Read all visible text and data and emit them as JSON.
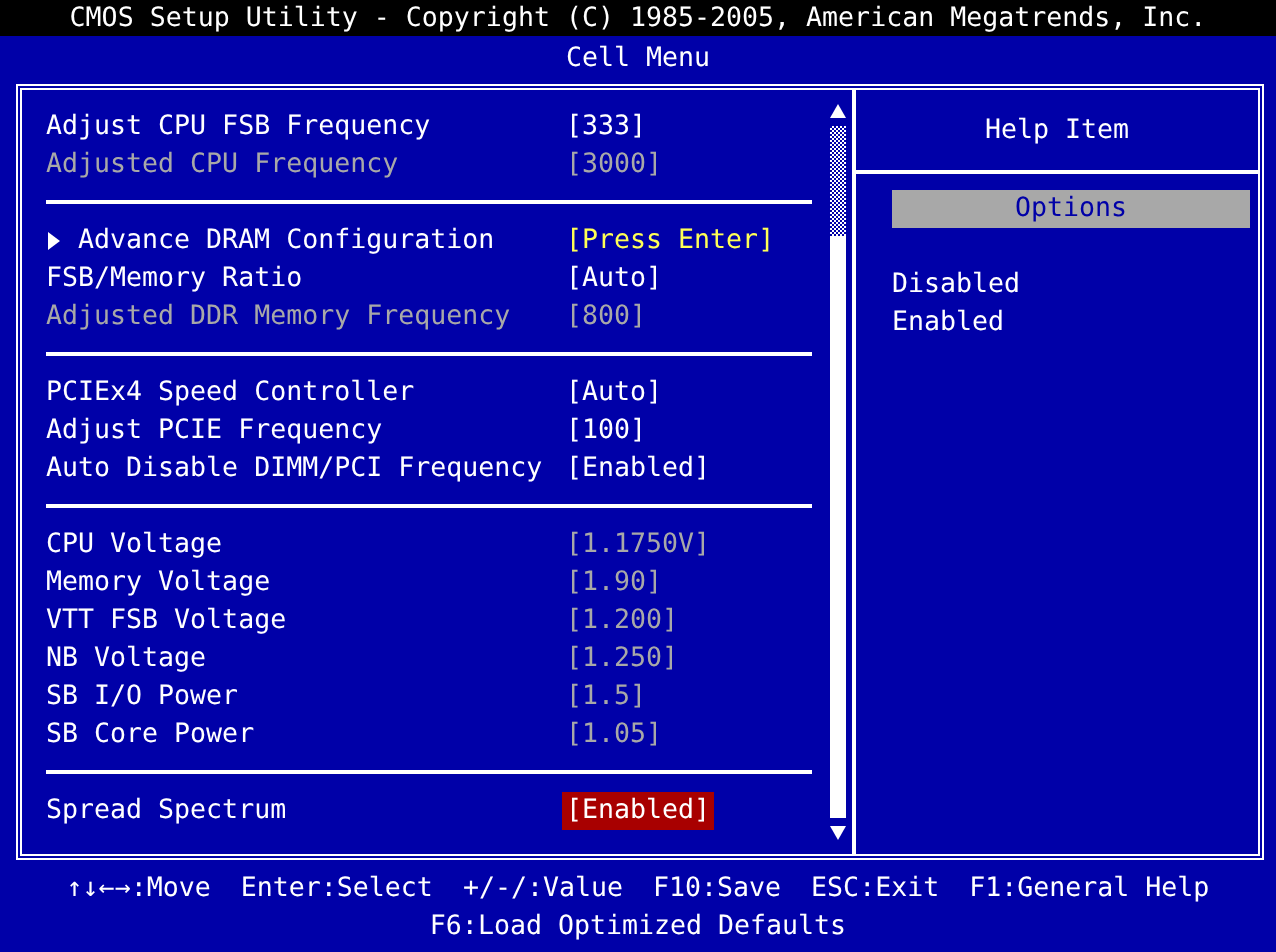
{
  "title_bar": {
    "title": "CMOS Setup Utility - Copyright (C) 1985-2005, American Megatrends, Inc."
  },
  "menu_title": "Cell Menu",
  "settings": {
    "groups": [
      {
        "items": [
          {
            "kind": "setting",
            "label": "Adjust CPU FSB Frequency",
            "value": "[333]",
            "disabled": false,
            "value_disabled": false,
            "selected": false
          },
          {
            "kind": "setting",
            "label": "Adjusted CPU Frequency",
            "value": "[3000]",
            "disabled": true,
            "value_disabled": true,
            "selected": false
          }
        ]
      },
      {
        "items": [
          {
            "kind": "submenu",
            "label": "Advance DRAM Configuration",
            "value": "[Press Enter]",
            "disabled": false,
            "value_disabled": false,
            "selected": false
          },
          {
            "kind": "setting",
            "label": "FSB/Memory Ratio",
            "value": "[Auto]",
            "disabled": false,
            "value_disabled": false,
            "selected": false
          },
          {
            "kind": "setting",
            "label": "Adjusted DDR Memory Frequency",
            "value": "[800]",
            "disabled": true,
            "value_disabled": true,
            "selected": false
          }
        ]
      },
      {
        "items": [
          {
            "kind": "setting",
            "label": "PCIEx4 Speed Controller",
            "value": "[Auto]",
            "disabled": false,
            "value_disabled": false,
            "selected": false
          },
          {
            "kind": "setting",
            "label": "Adjust PCIE Frequency",
            "value": "[100]",
            "disabled": false,
            "value_disabled": false,
            "selected": false
          },
          {
            "kind": "setting",
            "label": "Auto Disable DIMM/PCI Frequency",
            "value": "[Enabled]",
            "disabled": false,
            "value_disabled": false,
            "selected": false
          }
        ]
      },
      {
        "items": [
          {
            "kind": "setting",
            "label": "CPU Voltage",
            "value": "[1.1750V]",
            "disabled": false,
            "value_disabled": true,
            "selected": false
          },
          {
            "kind": "setting",
            "label": "Memory Voltage",
            "value": "[1.90]",
            "disabled": false,
            "value_disabled": true,
            "selected": false
          },
          {
            "kind": "setting",
            "label": "VTT FSB Voltage",
            "value": "[1.200]",
            "disabled": false,
            "value_disabled": true,
            "selected": false
          },
          {
            "kind": "setting",
            "label": "NB Voltage",
            "value": "[1.250]",
            "disabled": false,
            "value_disabled": true,
            "selected": false
          },
          {
            "kind": "setting",
            "label": "SB I/O Power",
            "value": "[1.5]",
            "disabled": false,
            "value_disabled": true,
            "selected": false
          },
          {
            "kind": "setting",
            "label": "SB Core Power",
            "value": "[1.05]",
            "disabled": false,
            "value_disabled": true,
            "selected": false
          }
        ]
      },
      {
        "items": [
          {
            "kind": "setting",
            "label": "Spread Spectrum",
            "value": "[Enabled]",
            "disabled": false,
            "value_disabled": false,
            "selected": true
          }
        ]
      }
    ]
  },
  "help_panel": {
    "title": "Help Item",
    "options_heading": "Options",
    "options": [
      "Disabled",
      "Enabled"
    ]
  },
  "footer": {
    "lines": [
      [
        "↑↓←→:Move",
        "Enter:Select",
        "+/-/:Value",
        "F10:Save",
        "ESC:Exit",
        "F1:General Help"
      ],
      [
        "F6:Load Optimized Defaults"
      ]
    ]
  }
}
